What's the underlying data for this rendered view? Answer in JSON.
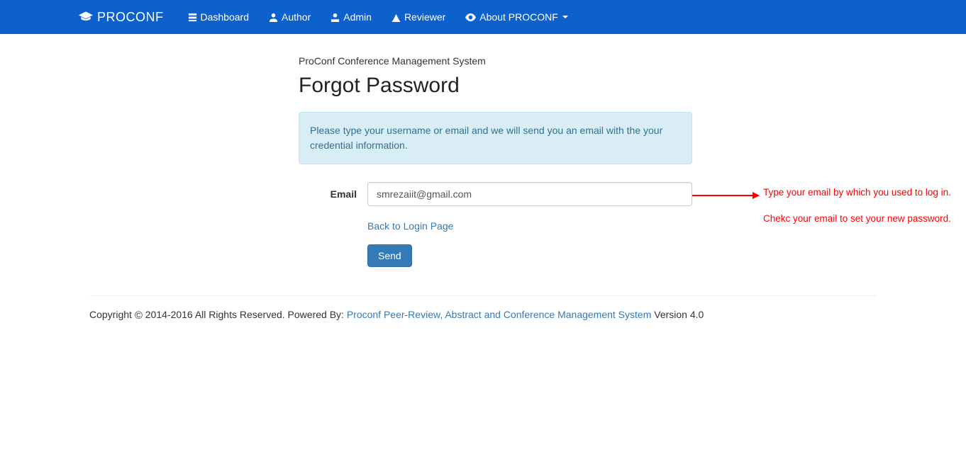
{
  "brand": {
    "name": "PROCONF"
  },
  "nav": {
    "items": [
      {
        "label": "Dashboard"
      },
      {
        "label": "Author"
      },
      {
        "label": "Admin"
      },
      {
        "label": "Reviewer"
      },
      {
        "label": "About PROCONF"
      }
    ]
  },
  "page": {
    "system_name": "ProConf Conference Management System",
    "title": "Forgot Password",
    "info_text": "Please type your username or email and we will send you an email with the your credential information."
  },
  "form": {
    "email_label": "Email",
    "email_value": "smrezaiit@gmail.com",
    "back_link": "Back to Login Page",
    "send_label": "Send"
  },
  "annotations": {
    "line1": "Type your email by which you used to log in.",
    "line2": "Chekc your email to set your new password."
  },
  "footer": {
    "prefix": "Copyright ",
    "years": " 2014-2016 All Rights Reserved. Powered By: ",
    "link": "Proconf Peer-Review, Abstract and Conference Management System",
    "suffix": " Version 4.0"
  }
}
